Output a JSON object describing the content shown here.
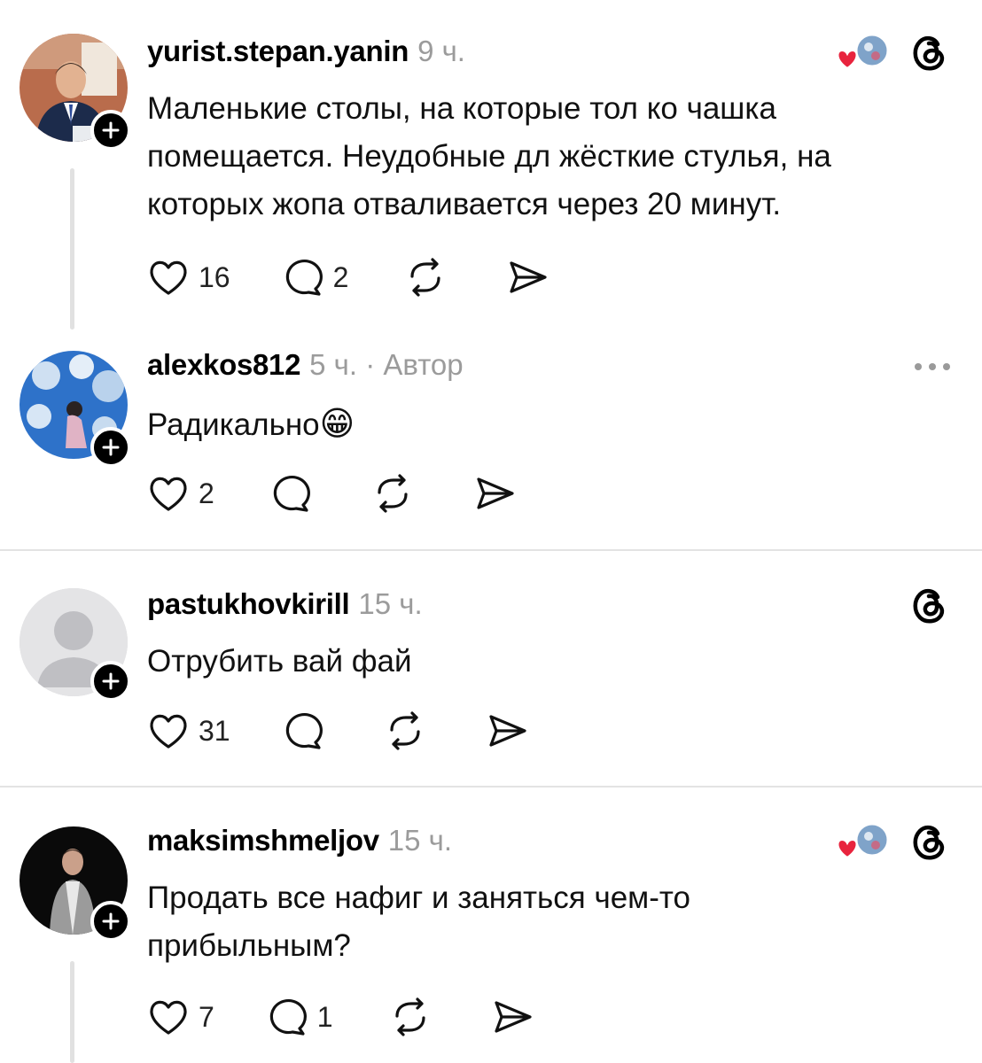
{
  "posts": [
    {
      "username": "yurist.stepan.yanin",
      "time": "9 ч.",
      "text": "Маленькие столы, на которые тол ко чашка помещается. Неудобные дл жёсткие стулья, на которых жопа отваливается через 20 минут.",
      "likes": "16",
      "replies": "2"
    },
    {
      "username": "alexkos812",
      "time": "5 ч.",
      "author_badge": " · Автор",
      "text": "Радикально",
      "emoji": "😁",
      "likes": "2",
      "replies": ""
    },
    {
      "username": "pastukhovkirill",
      "time": "15 ч.",
      "text": "Отрубить вай фай",
      "likes": "31",
      "replies": ""
    },
    {
      "username": "maksimshmeljov",
      "time": "15 ч.",
      "text_line1": "Продать все нафиг и заняться чем-то",
      "text_line2": "прибыльным?",
      "likes": "7",
      "replies": "1"
    }
  ],
  "icons": {
    "like": "heart-icon",
    "reply": "comment-icon",
    "repost": "repost-icon",
    "share": "share-icon",
    "app": "threads-logo-icon",
    "more": "more-icon",
    "follow": "plus-icon"
  },
  "colors": {
    "accent_heart": "#e8233d",
    "muted_text": "#9b9b9b",
    "divider": "#e3e3e3"
  }
}
